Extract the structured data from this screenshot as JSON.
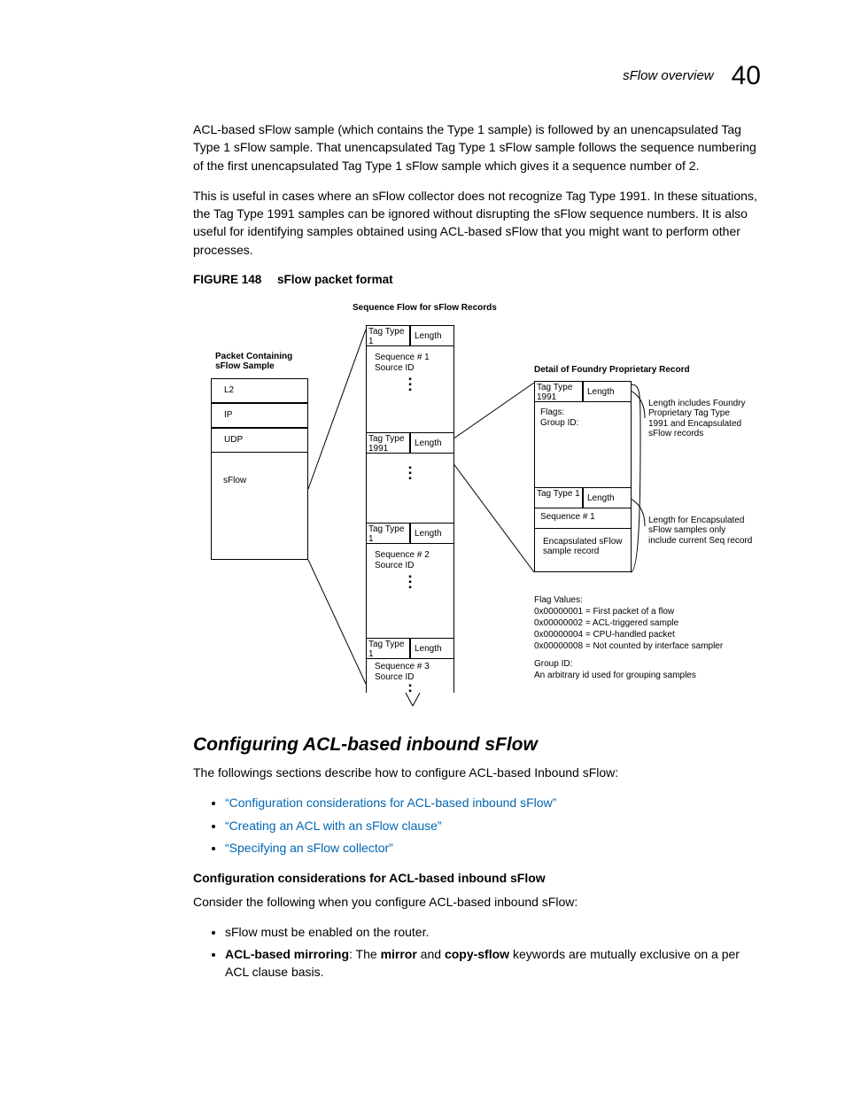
{
  "header": {
    "section": "sFlow overview",
    "pageNum": "40"
  },
  "para1": "ACL-based sFlow sample (which contains the Type 1 sample) is followed by an unencapsulated Tag Type 1 sFlow sample. That unencapsulated Tag Type 1 sFlow sample follows the sequence numbering of the first unencapsulated Tag Type 1 sFlow sample which gives it a sequence number of 2.",
  "para2": "This is useful in cases where an sFlow collector does not recognize Tag Type 1991. In these situations, the Tag Type 1991 samples can be ignored without disrupting the sFlow sequence numbers. It is also useful for identifying samples obtained using ACL-based sFlow that you might want to perform other processes.",
  "figCaption": {
    "label": "FIGURE 148",
    "text": "sFlow packet format"
  },
  "fig": {
    "seqFlowTitle": "Sequence Flow for sFlow Records",
    "packetTitle": "Packet Containing sFlow Sample",
    "detailTitle": "Detail of Foundry Proprietary Record",
    "l2": "L2",
    "ip": "IP",
    "udp": "UDP",
    "sflow": "sFlow",
    "tagType1": "Tag Type 1",
    "tagType1991": "Tag Type 1991",
    "length": "Length",
    "seq1": "Sequence # 1",
    "seq2": "Sequence # 2",
    "seq3": "Sequence # 3",
    "sourceId": "Source ID",
    "flags": "Flags:",
    "groupId": "Group ID:",
    "seq1b": "Sequence # 1",
    "encap": "Encapsulated sFlow sample record",
    "note1": "Length includes Foundry Proprietary Tag Type 1991 and Encapsulated sFlow records",
    "note2": "Length for Encapsulated sFlow samples only include current Seq record",
    "flagValuesHeader": "Flag Values:",
    "fv1": "0x00000001 = First packet of a flow",
    "fv2": "0x00000002 = ACL-triggered sample",
    "fv3": "0x00000004 = CPU-handled packet",
    "fv4": "0x00000008 = Not counted by interface sampler",
    "groupIdHeader": "Group ID:",
    "groupIdText": "An arbitrary id used for grouping samples"
  },
  "sect": {
    "title": "Configuring ACL-based inbound sFlow",
    "intro": "The followings sections describe how to configure ACL-based Inbound sFlow:",
    "links": {
      "l1": "“Configuration considerations for ACL-based inbound sFlow”",
      "l2": "“Creating an ACL with an sFlow clause”",
      "l3": "“Specifying an sFlow collector”"
    },
    "sub1": {
      "title": "Configuration considerations for ACL-based inbound sFlow",
      "intro": "Consider the following when you configure ACL-based inbound sFlow:",
      "b1": "sFlow must be enabled on the router.",
      "b2pre": "ACL-based mirroring",
      "b2mid": ": The ",
      "b2kw1": "mirror",
      "b2mid2": " and ",
      "b2kw2": "copy-sflow",
      "b2post": " keywords are mutually exclusive on a per ACL clause basis."
    }
  }
}
